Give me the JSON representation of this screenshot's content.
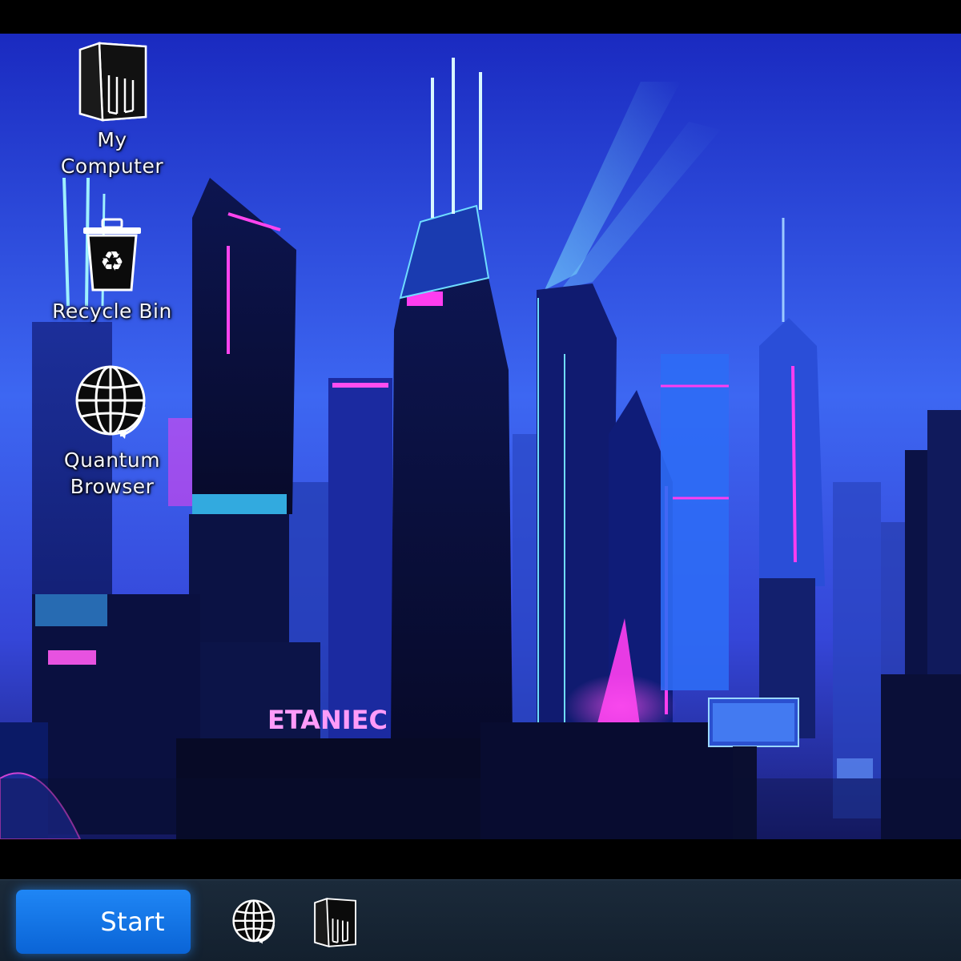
{
  "desktop": {
    "icons": [
      {
        "label": "My\nComputer",
        "icon": "computer-tower-icon"
      },
      {
        "label": "Recycle Bin",
        "icon": "recycle-bin-icon"
      },
      {
        "label": "Quantum\nBrowser",
        "icon": "globe-icon"
      }
    ],
    "wallpaper": {
      "sign_text": "ETANIEC"
    }
  },
  "taskbar": {
    "start_label": "Start",
    "pinned": [
      {
        "icon": "globe-icon"
      },
      {
        "icon": "computer-tower-icon"
      }
    ]
  },
  "colors": {
    "accent": "#0a6ee0",
    "taskbar": "#16222f",
    "neon_pink": "#ff3df0",
    "neon_cyan": "#57d8ff"
  }
}
